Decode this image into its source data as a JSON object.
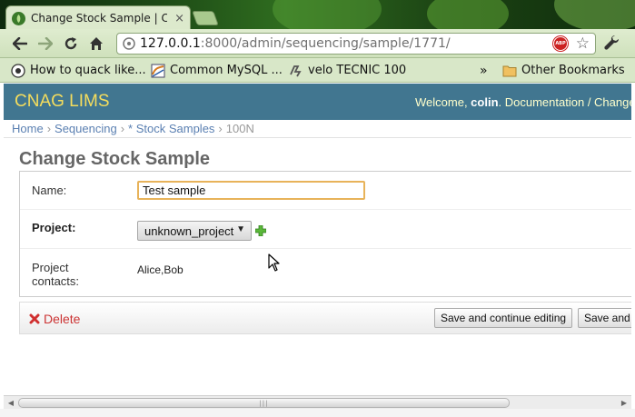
{
  "browser": {
    "tab_title": "Change Stock Sample | CNA",
    "tab_close": "×",
    "url_host": "127.0.0.1",
    "url_path": ":8000/admin/sequencing/sample/1771/",
    "abp_label": "ABP",
    "bookmarks": [
      {
        "label": "How to quack like...",
        "icon": "duck-icon"
      },
      {
        "label": "Common MySQL ...",
        "icon": "mysql-icon"
      },
      {
        "label": "velo TECNIC 100",
        "icon": "velo-icon"
      }
    ],
    "bookmarks_overflow": "»",
    "other_bookmarks": "Other Bookmarks"
  },
  "header": {
    "branding": "CNAG LIMS",
    "welcome_prefix": "Welcome, ",
    "username": "colin",
    "welcome_suffix": ". ",
    "documentation": "Documentation",
    "separator": " / ",
    "change_password": "Change password"
  },
  "breadcrumbs": {
    "home": "Home",
    "app": "Sequencing",
    "model": "* Stock Samples",
    "current": "100N",
    "separator": "›"
  },
  "content": {
    "title": "Change Stock Sample",
    "fields": {
      "name_label": "Name:",
      "name_value": "Test sample",
      "project_label": "Project:",
      "project_value": "unknown_project",
      "contacts_label_1": "Project",
      "contacts_label_2": "contacts:",
      "contacts_value": "Alice,Bob"
    },
    "actions": {
      "delete": "Delete",
      "save_continue": "Save and continue editing",
      "save_add": "Save and add another"
    }
  },
  "scrollbar": {
    "grip": "|||",
    "left_arrow": "◀",
    "right_arrow": "▶"
  },
  "colors": {
    "header_bg": "#417690",
    "branding": "#f5dd5d",
    "link": "#5b80b2",
    "delete": "#cc3434",
    "input_focus": "#e8b35a"
  }
}
